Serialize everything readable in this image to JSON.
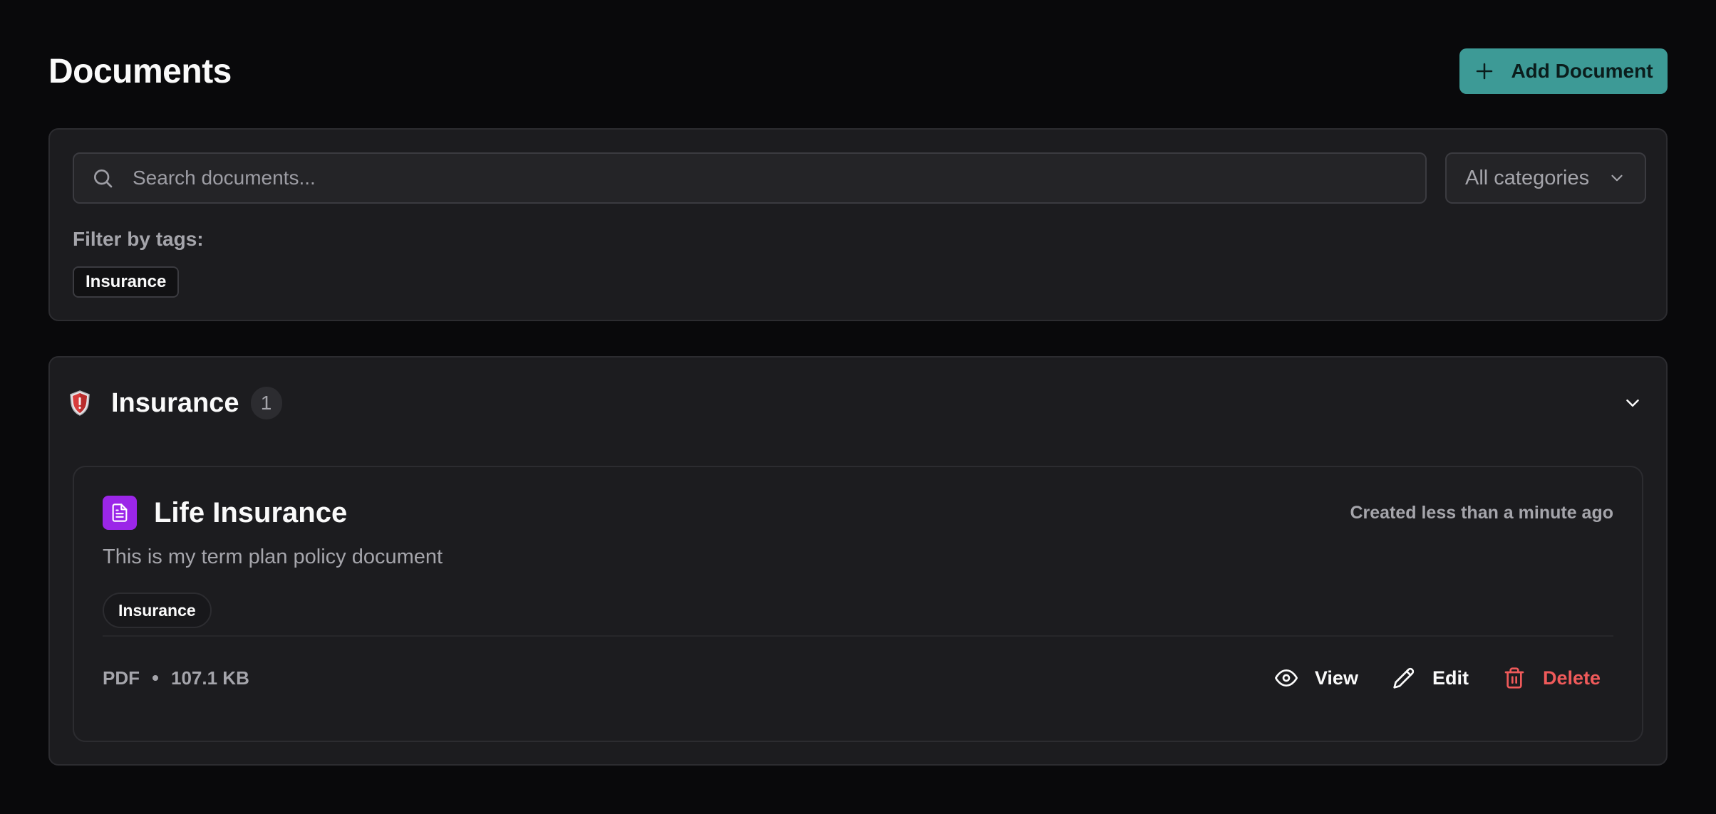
{
  "header": {
    "title": "Documents",
    "add_button_label": "Add Document"
  },
  "filters": {
    "search_placeholder": "Search documents...",
    "search_value": "",
    "category_selected": "All categories",
    "tags_label": "Filter by tags:",
    "tags": [
      "Insurance"
    ]
  },
  "groups": [
    {
      "name": "Insurance",
      "count": "1",
      "documents": [
        {
          "title": "Life Insurance",
          "created": "Created less than a minute ago",
          "description": "This is my term plan policy document",
          "tags": [
            "Insurance"
          ],
          "file_type": "PDF",
          "file_size": "107.1 KB",
          "actions": {
            "view": "View",
            "edit": "Edit",
            "delete": "Delete"
          }
        }
      ]
    }
  ],
  "colors": {
    "accent": "#3d9a96",
    "doc_icon": "#9b26e8",
    "danger": "#ef5a5a",
    "background": "#09090b",
    "card": "#1c1c1f"
  },
  "icons": {
    "add": "plus-icon",
    "search": "search-icon",
    "category_dropdown": "chevron-down-icon",
    "group": "shield-icon",
    "group_toggle": "chevron-down-icon",
    "document": "file-text-icon",
    "view": "eye-icon",
    "edit": "pencil-icon",
    "delete": "trash-icon"
  }
}
